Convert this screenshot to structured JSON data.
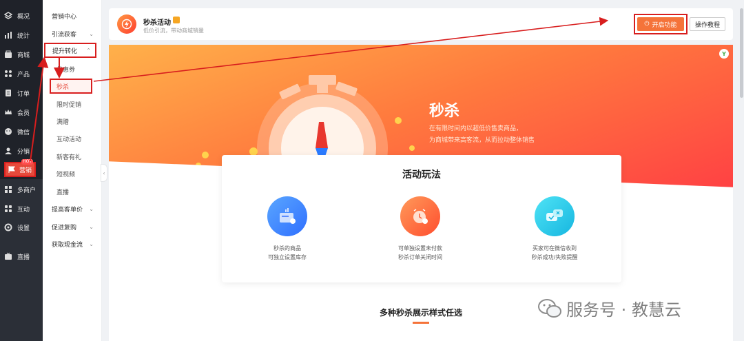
{
  "nav": {
    "items": [
      {
        "label": "概况",
        "icon": "dashboard-icon"
      },
      {
        "label": "统计",
        "icon": "stats-icon"
      },
      {
        "label": "商城",
        "icon": "mall-icon"
      },
      {
        "label": "产品",
        "icon": "product-icon"
      },
      {
        "label": "订单",
        "icon": "order-icon"
      },
      {
        "label": "会员",
        "icon": "member-icon"
      },
      {
        "label": "微信",
        "icon": "wechat-icon"
      },
      {
        "label": "分销",
        "icon": "distribution-icon"
      },
      {
        "label": "营销",
        "icon": "marketing-icon",
        "badge": "HOT"
      },
      {
        "label": "多商户",
        "icon": "multi-merchant-icon"
      },
      {
        "label": "互动",
        "icon": "interaction-icon"
      },
      {
        "label": "设置",
        "icon": "settings-icon"
      },
      {
        "label": "直播",
        "icon": "live-icon"
      }
    ]
  },
  "subnav": {
    "marketing_center": "营销中心",
    "traffic": "引流获客",
    "conversion": "提升转化",
    "coupon": "优惠券",
    "flash_sale": "秒杀",
    "limited_promo": "限时促销",
    "gift": "满赠",
    "interactive": "互动活动",
    "new_user_gift": "新客有礼",
    "short_video": "短视频",
    "live": "直播",
    "raise_order": "提高客单价",
    "repurchase": "促进复购",
    "cash_flow": "获取现金流"
  },
  "header": {
    "title": "秒杀活动",
    "subtitle": "低价引流，带动商城销量",
    "enable_button": "开启功能",
    "tutorial_button": "操作教程"
  },
  "hero": {
    "title": "秒杀",
    "desc1": "在有限时间内以超低价售卖商品，",
    "desc2": "为商城带来高客流，从而拉动整体销售"
  },
  "play": {
    "title": "活动玩法",
    "features": [
      {
        "line1": "秒杀的商品",
        "line2": "可独立设置库存",
        "icon": "product-stock-icon",
        "color": "#3b8cff"
      },
      {
        "line1": "可单独设置未付款",
        "line2": "秒杀订单关闭时间",
        "icon": "alarm-clock-icon",
        "color": "#ff6a3d"
      },
      {
        "line1": "买家可在微信收到",
        "line2": "秒杀成功/失败提醒",
        "icon": "chat-notify-icon",
        "color": "#1fc8e8"
      }
    ]
  },
  "styles_title": "多种秒杀展示样式任选",
  "watermark": "服务号 · 教慧云",
  "colors": {
    "accent": "#f5733a",
    "highlight_box": "#d81e1e",
    "nav_bg": "#1f2229"
  }
}
